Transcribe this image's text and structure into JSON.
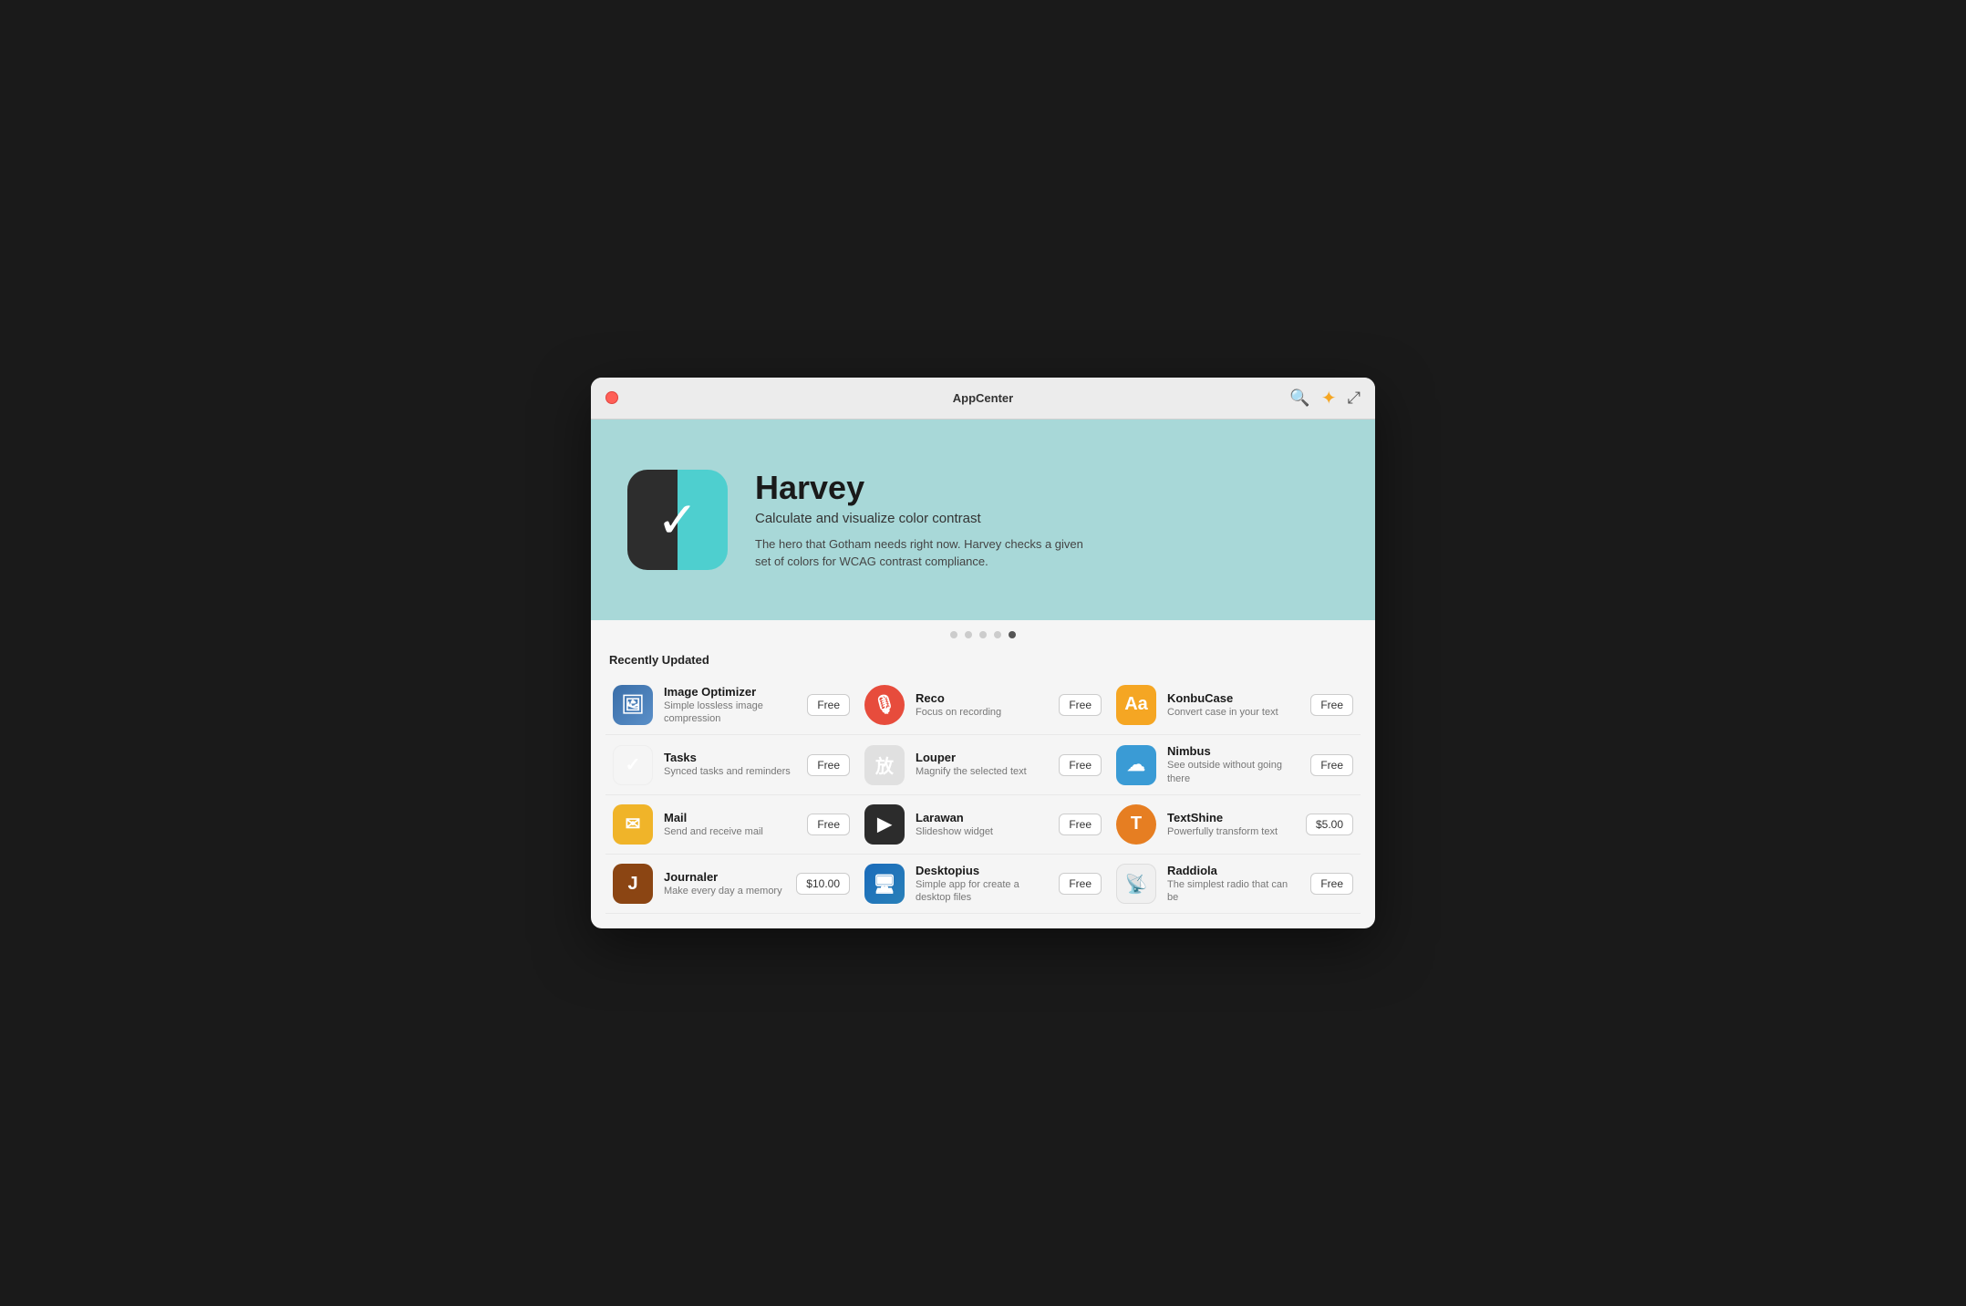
{
  "window": {
    "title": "AppCenter",
    "close_label": "×"
  },
  "hero": {
    "app_name": "Harvey",
    "app_subtitle": "Calculate and visualize color contrast",
    "app_desc": "The hero that Gotham needs right now. Harvey checks a given set of colors for WCAG contrast compliance.",
    "icon_symbol": "✓"
  },
  "carousel": {
    "dots": [
      false,
      false,
      false,
      false,
      true
    ]
  },
  "recently_updated": {
    "label": "Recently Updated"
  },
  "apps": [
    {
      "name": "Image Optimizer",
      "desc": "Simple lossless image compression",
      "price": "Free",
      "icon_class": "icon-image-optimizer",
      "icon_symbol": "🖼"
    },
    {
      "name": "Reco",
      "desc": "Focus on recording",
      "price": "Free",
      "icon_class": "icon-reco",
      "icon_symbol": "🎙"
    },
    {
      "name": "KonbuCase",
      "desc": "Convert case in your text",
      "price": "Free",
      "icon_class": "icon-konbucase",
      "icon_symbol": "Aa"
    },
    {
      "name": "Tasks",
      "desc": "Synced tasks and reminders",
      "price": "Free",
      "icon_class": "icon-tasks",
      "icon_symbol": "✓"
    },
    {
      "name": "Louper",
      "desc": "Magnify the selected text",
      "price": "Free",
      "icon_class": "icon-louper",
      "icon_symbol": "放"
    },
    {
      "name": "Nimbus",
      "desc": "See outside without going there",
      "price": "Free",
      "icon_class": "icon-nimbus",
      "icon_symbol": "☁"
    },
    {
      "name": "Mail",
      "desc": "Send and receive mail",
      "price": "Free",
      "icon_class": "icon-mail",
      "icon_symbol": "✉"
    },
    {
      "name": "Larawan",
      "desc": "Slideshow widget",
      "price": "Free",
      "icon_class": "icon-larawan",
      "icon_symbol": "▶"
    },
    {
      "name": "TextShine",
      "desc": "Powerfully transform text",
      "price": "$5.00",
      "icon_class": "icon-textshine",
      "icon_symbol": "T"
    },
    {
      "name": "Journaler",
      "desc": "Make every day a memory",
      "price": "$10.00",
      "icon_class": "icon-journaler",
      "icon_symbol": "J"
    },
    {
      "name": "Desktopius",
      "desc": "Simple app for create a desktop files",
      "price": "Free",
      "icon_class": "icon-desktopius",
      "icon_symbol": "🖥"
    },
    {
      "name": "Raddiola",
      "desc": "The simplest radio that can be",
      "price": "Free",
      "icon_class": "icon-raddiola",
      "icon_symbol": "📡"
    }
  ]
}
